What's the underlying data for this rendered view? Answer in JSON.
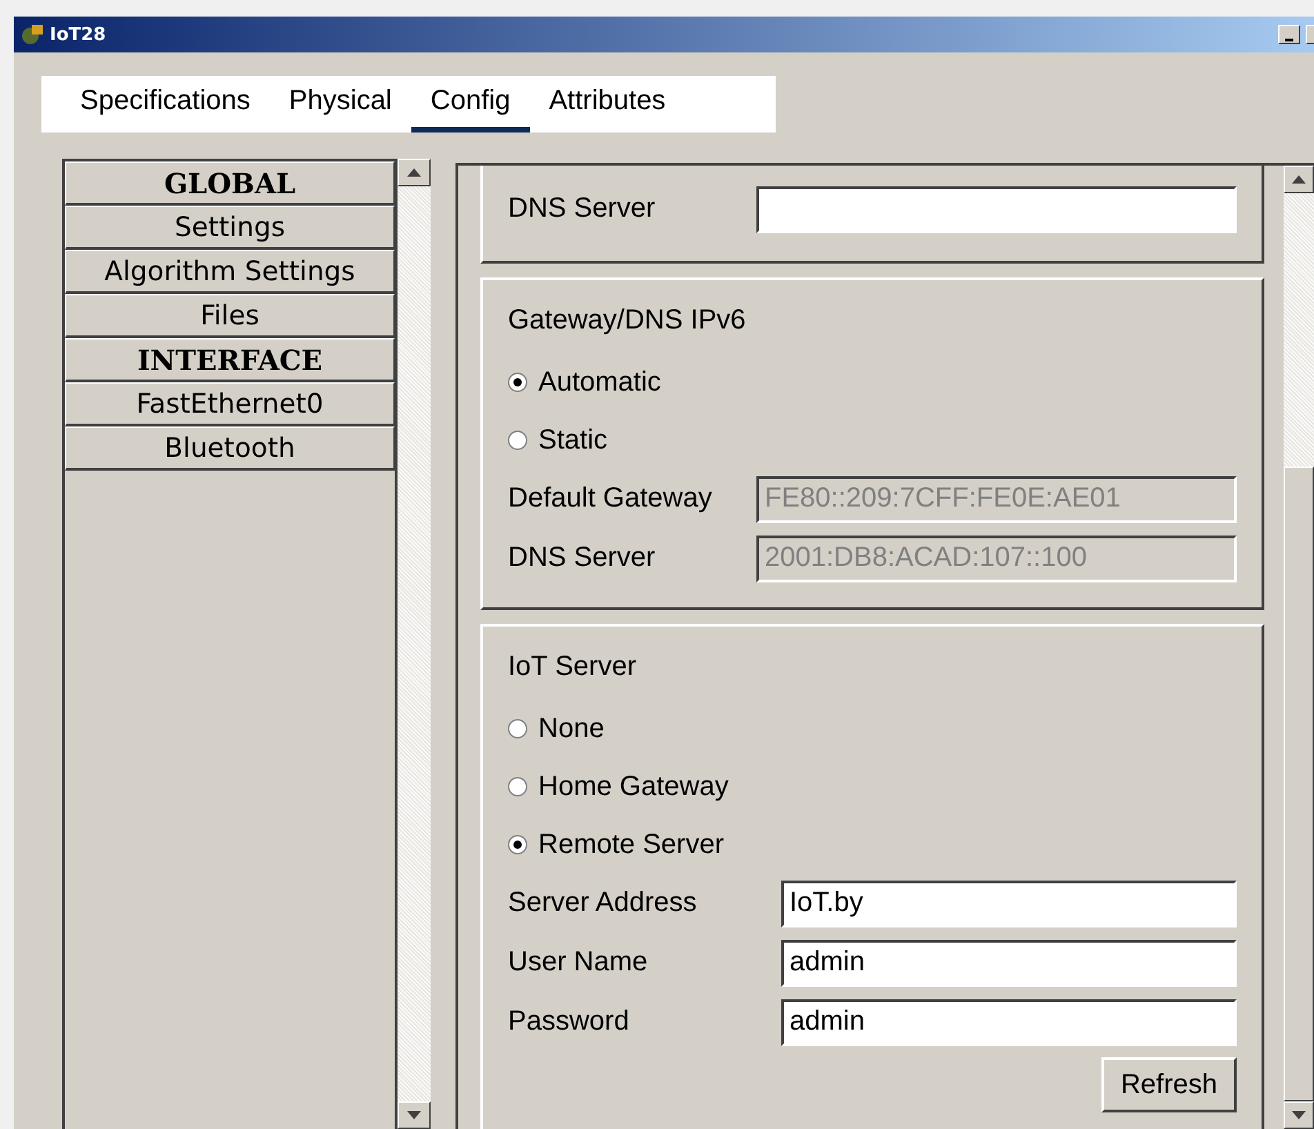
{
  "window": {
    "title": "IoT28"
  },
  "tabs": [
    {
      "label": "Specifications",
      "selected": false
    },
    {
      "label": "Physical",
      "selected": false
    },
    {
      "label": "Config",
      "selected": true
    },
    {
      "label": "Attributes",
      "selected": false
    }
  ],
  "sidebar": {
    "items": [
      {
        "label": "GLOBAL",
        "kind": "header"
      },
      {
        "label": "Settings",
        "kind": "item"
      },
      {
        "label": "Algorithm Settings",
        "kind": "item"
      },
      {
        "label": "Files",
        "kind": "item"
      },
      {
        "label": "INTERFACE",
        "kind": "header"
      },
      {
        "label": "FastEthernet0",
        "kind": "item"
      },
      {
        "label": "Bluetooth",
        "kind": "item"
      }
    ]
  },
  "sections": [
    {
      "fields": [
        {
          "label": "DNS Server",
          "disabled": false
        }
      ]
    },
    {
      "title": "Gateway/DNS IPv6",
      "radios": [
        {
          "label": "Automatic",
          "selected": true
        },
        {
          "label": "Static",
          "selected": false
        }
      ],
      "fields": [
        {
          "label": "Default Gateway",
          "value": "FE80::209:7CFF:FE0E:AE01",
          "disabled": true
        },
        {
          "label": "DNS Server",
          "value": "2001:DB8:ACAD:107::100",
          "disabled": true
        }
      ]
    },
    {
      "title": "IoT Server",
      "radios": [
        {
          "label": "None",
          "selected": false
        },
        {
          "label": "Home Gateway",
          "selected": false
        },
        {
          "label": "Remote Server",
          "selected": true
        }
      ],
      "fields": [
        {
          "label": "Server Address",
          "value": "IoT.by",
          "disabled": false
        },
        {
          "label": "User Name",
          "value": "admin",
          "disabled": false
        },
        {
          "label": "Password",
          "value": "admin",
          "disabled": false
        }
      ],
      "buttons": [
        "Refresh"
      ]
    }
  ]
}
